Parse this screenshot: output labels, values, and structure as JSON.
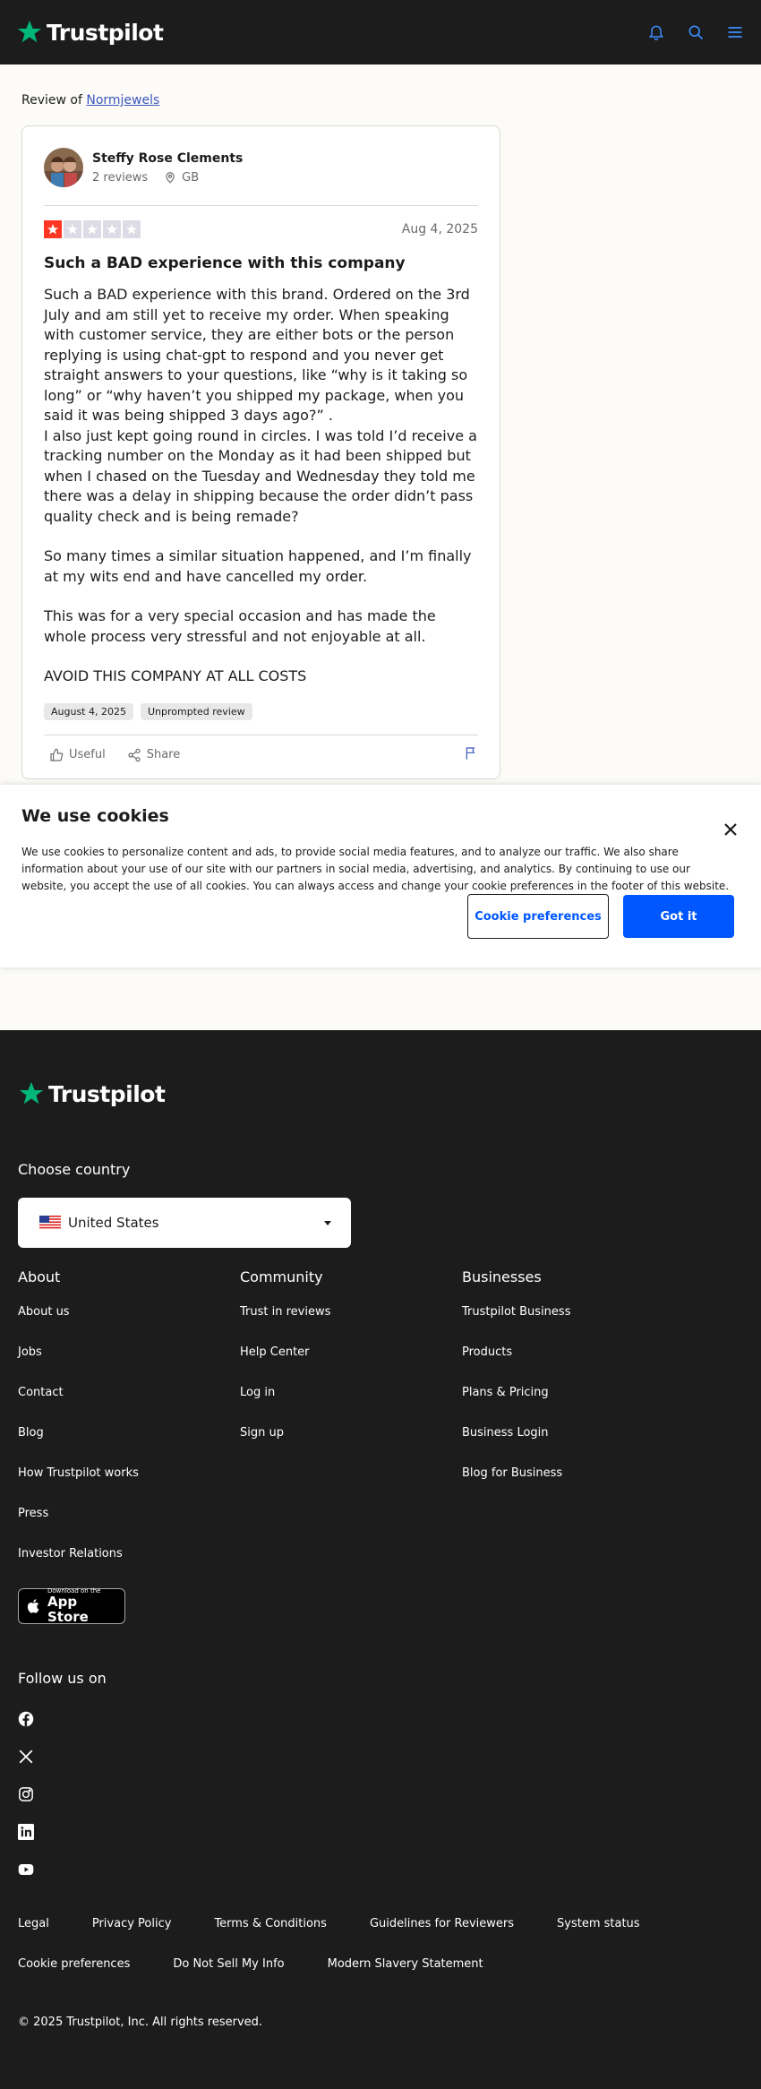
{
  "header": {
    "brand": "Trustpilot",
    "icons": [
      "bell-icon",
      "search-icon",
      "menu-icon"
    ],
    "accent": "#00b67a"
  },
  "breadcrumb": {
    "prefix": "Review of",
    "company": "Normjewels"
  },
  "review": {
    "reviewer_name": "Steffy Rose Clements",
    "reviews_count": "2 reviews",
    "country": "GB",
    "rating": 1,
    "max_rating": 5,
    "date": "Aug 4, 2025",
    "title": "Such a BAD experience with this company",
    "body": [
      "Such a BAD experience with this brand. Ordered on the 3rd July and am still yet to receive my order. When speaking with customer service, they are either bots or the person replying is using chat-gpt to respond and you never get straight answers to your questions, like “why is it taking so long” or “why haven’t you shipped my package, when you said it was being shipped 3 days ago?” .",
      "I also just kept going round in circles. I was told I’d receive a tracking number on the Monday as it had been shipped but when I chased on the Tuesday and Wednesday they told me there was a delay in shipping because the order didn’t pass quality check and is being remade?",
      "So many times a similar situation happened, and I’m finally at my wits end and have cancelled my order.",
      "This was for a very special occasion and has made the whole process very stressful and not enjoyable at all.",
      "AVOID THIS COMPANY AT ALL COSTS"
    ],
    "tags": [
      "August 4, 2025",
      "Unprompted review"
    ],
    "actions": {
      "useful": "Useful",
      "share": "Share"
    },
    "star_color": "#ff3722",
    "empty_star_color": "#dcdce6"
  },
  "cookie": {
    "title": "We use cookies",
    "text": "We use cookies to personalize content and ads, to provide social media features, and to analyze our traffic. We also share information about your use of our site with our partners in social media, advertising, and analytics. By continuing to use our website, you accept the use of all cookies. You can always access and change your cookie preferences in the footer of this website.",
    "preferences_label": "Cookie preferences",
    "accept_label": "Got it",
    "accent": "#0057ff"
  },
  "footer": {
    "brand": "Trustpilot",
    "choose_country": "Choose country",
    "country": "United States",
    "columns": [
      {
        "heading": "About",
        "links": [
          "About us",
          "Jobs",
          "Contact",
          "Blog",
          "How Trustpilot works",
          "Press",
          "Investor Relations"
        ]
      },
      {
        "heading": "Community",
        "links": [
          "Trust in reviews",
          "Help Center",
          "Log in",
          "Sign up"
        ]
      },
      {
        "heading": "Businesses",
        "links": [
          "Trustpilot Business",
          "Products",
          "Plans & Pricing",
          "Business Login",
          "Blog for Business"
        ]
      }
    ],
    "app_store": {
      "small": "Download on the",
      "big": "App Store"
    },
    "follow_us": "Follow us on",
    "socials": [
      "facebook-icon",
      "x-icon",
      "instagram-icon",
      "linkedin-icon",
      "youtube-icon"
    ],
    "legal_row1": [
      "Legal",
      "Privacy Policy",
      "Terms & Conditions",
      "Guidelines for Reviewers",
      "System status"
    ],
    "legal_row2": [
      "Cookie preferences",
      "Do Not Sell My Info",
      "Modern Slavery Statement"
    ],
    "copyright": "© 2025 Trustpilot, Inc. All rights reserved."
  }
}
